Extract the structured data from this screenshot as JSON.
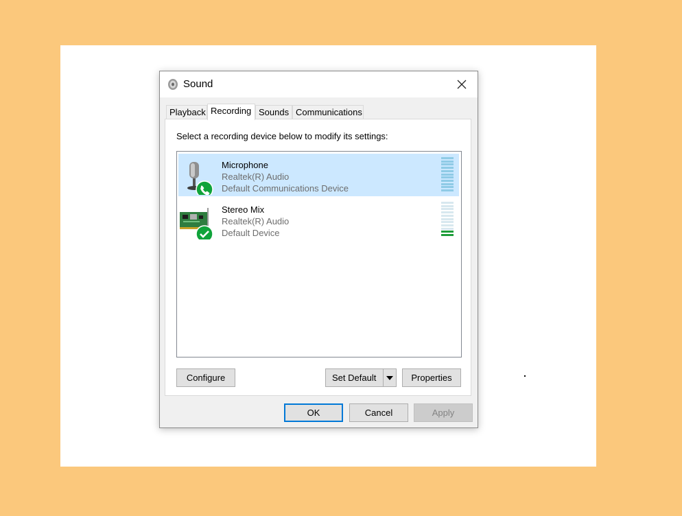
{
  "window": {
    "title": "Sound",
    "close_icon": "close-icon"
  },
  "tabs": [
    {
      "label": "Playback",
      "active": false
    },
    {
      "label": "Recording",
      "active": true
    },
    {
      "label": "Sounds",
      "active": false
    },
    {
      "label": "Communications",
      "active": false
    }
  ],
  "recording": {
    "instruction": "Select a recording device below to modify its settings:",
    "devices": [
      {
        "name": "Microphone",
        "driver": "Realtek(R) Audio",
        "status": "Default Communications Device",
        "icon": "microphone-icon",
        "badge": "phone-badge-icon",
        "selected": true,
        "level": 0
      },
      {
        "name": "Stereo Mix",
        "driver": "Realtek(R) Audio",
        "status": "Default Device",
        "icon": "sound-card-icon",
        "badge": "checkmark-badge-icon",
        "selected": false,
        "level": 0.2
      }
    ]
  },
  "buttons": {
    "configure": "Configure",
    "set_default": "Set Default",
    "properties": "Properties",
    "ok": "OK",
    "cancel": "Cancel",
    "apply": "Apply"
  },
  "colors": {
    "background": "#fbc87c",
    "selection": "#cce8ff",
    "default_button_border": "#0078d7",
    "badge_green": "#10a33a"
  }
}
